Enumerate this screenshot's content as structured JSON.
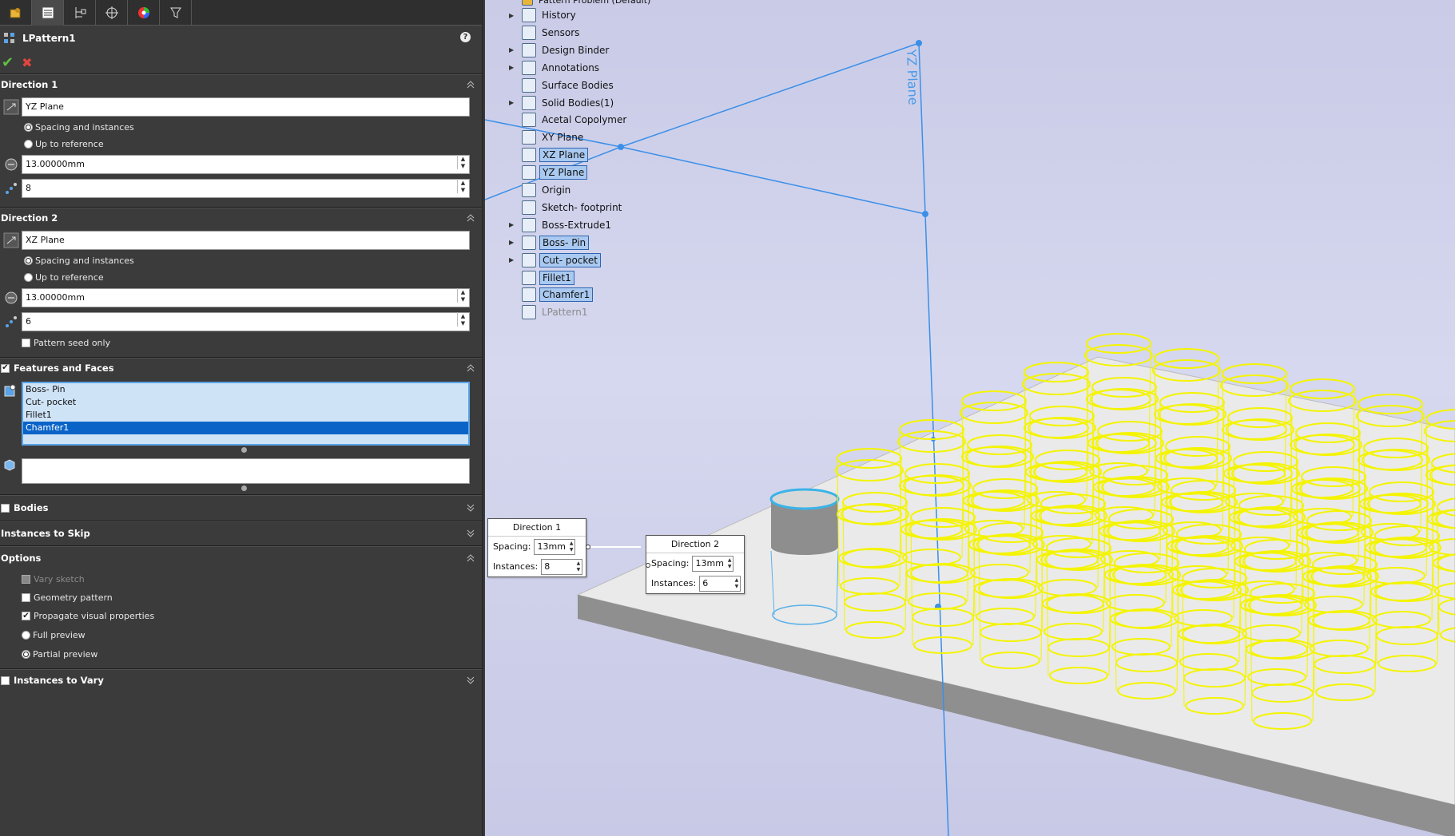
{
  "property_manager": {
    "title": "LPattern1",
    "help_label": "?",
    "tabs": [
      "feature-manager",
      "property-manager",
      "configuration-manager",
      "dimxpert-manager",
      "display-manager",
      "cam-manager"
    ],
    "direction1": {
      "header": "Direction 1",
      "reference": "YZ Plane",
      "opt_spacing": "Spacing and instances",
      "opt_upto": "Up to reference",
      "spacing": "13.00000mm",
      "instances": "8"
    },
    "direction2": {
      "header": "Direction 2",
      "reference": "XZ  Plane",
      "opt_spacing": "Spacing and instances",
      "opt_upto": "Up to reference",
      "spacing": "13.00000mm",
      "instances": "6",
      "seed_only": "Pattern seed only"
    },
    "features": {
      "header": "Features and Faces",
      "items": [
        "Boss- Pin",
        "Cut- pocket",
        "Fillet1",
        "Chamfer1"
      ],
      "selected": "Chamfer1"
    },
    "bodies_header": "Bodies",
    "skip_header": "Instances to Skip",
    "options": {
      "header": "Options",
      "vary_sketch": "Vary sketch",
      "geometry_pattern": "Geometry pattern",
      "propagate": "Propagate visual properties",
      "full_preview": "Full preview",
      "partial_preview": "Partial preview"
    },
    "vary_header": "Instances to Vary"
  },
  "tree": {
    "items": [
      {
        "label": "History",
        "arrow": true,
        "hl": false
      },
      {
        "label": "Sensors",
        "arrow": false,
        "hl": false
      },
      {
        "label": "Design Binder",
        "arrow": true,
        "hl": false
      },
      {
        "label": "Annotations",
        "arrow": true,
        "hl": false
      },
      {
        "label": "Surface Bodies",
        "arrow": false,
        "hl": false
      },
      {
        "label": "Solid Bodies(1)",
        "arrow": true,
        "hl": false
      },
      {
        "label": "Acetal Copolymer",
        "arrow": false,
        "hl": false
      },
      {
        "label": "XY  Plane",
        "arrow": false,
        "hl": false
      },
      {
        "label": "XZ  Plane",
        "arrow": false,
        "hl": true
      },
      {
        "label": "YZ Plane",
        "arrow": false,
        "hl": true
      },
      {
        "label": "Origin",
        "arrow": false,
        "hl": false
      },
      {
        "label": "Sketch- footprint",
        "arrow": false,
        "hl": false
      },
      {
        "label": "Boss-Extrude1",
        "arrow": true,
        "hl": false
      },
      {
        "label": "Boss- Pin",
        "arrow": true,
        "hl": true
      },
      {
        "label": "Cut- pocket",
        "arrow": true,
        "hl": true
      },
      {
        "label": "Fillet1",
        "arrow": false,
        "hl": true
      },
      {
        "label": "Chamfer1",
        "arrow": false,
        "hl": true
      },
      {
        "label": "LPattern1",
        "arrow": false,
        "hl": false,
        "grey": true
      }
    ]
  },
  "viewport": {
    "plane_label": "YZ Plane",
    "callout1": {
      "title": "Direction 1",
      "spacing_label": "Spacing:",
      "spacing": "13mm",
      "instances_label": "Instances:",
      "instances": "8"
    },
    "callout2": {
      "title": "Direction 2",
      "spacing_label": "Spacing:",
      "spacing": "13mm",
      "instances_label": "Instances:",
      "instances": "6"
    }
  },
  "colors": {
    "accent": "#3b8fe8",
    "preview": "#f4f400",
    "panel": "#3b3b3b"
  }
}
